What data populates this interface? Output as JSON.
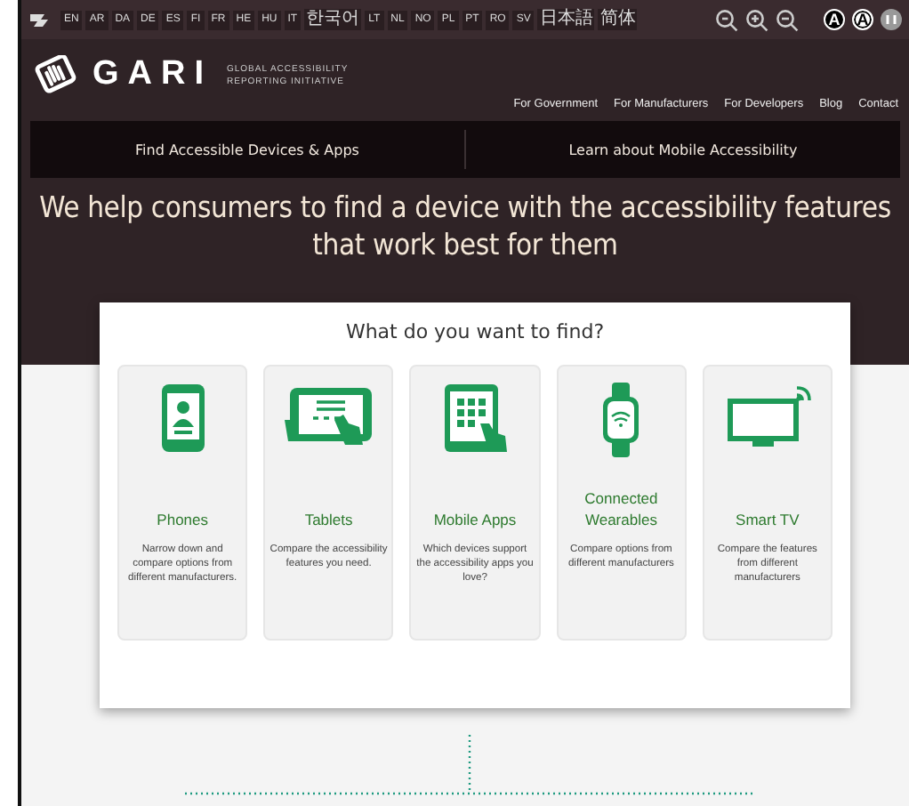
{
  "languages": [
    "EN",
    "AR",
    "DA",
    "DE",
    "ES",
    "FI",
    "FR",
    "HE",
    "HU",
    "IT",
    "한국어",
    "LT",
    "NL",
    "NO",
    "PL",
    "PT",
    "RO",
    "SV",
    "日本語",
    "简体"
  ],
  "contrast_buttons": [
    {
      "label": "A",
      "kind": "dark"
    },
    {
      "label": "A",
      "kind": "light"
    }
  ],
  "logo": {
    "name": "GARI",
    "tagline_1": "GLOBAL ACCESSIBILITY",
    "tagline_2": "REPORTING INITIATIVE"
  },
  "menu": [
    "For Government",
    "For Manufacturers",
    "For Developers",
    "Blog",
    "Contact"
  ],
  "tabs": [
    "Find Accessible Devices & Apps",
    "Learn about Mobile Accessibility"
  ],
  "headline": "We help consumers to find a device with the accessibility features that work best for them",
  "finder": {
    "title": "What do you want to find?",
    "items": [
      {
        "title": "Phones",
        "text": "Narrow down and compare options from different manufacturers."
      },
      {
        "title": "Tablets",
        "text": "Compare the accessibility features you need."
      },
      {
        "title": "Mobile Apps",
        "text": "Which devices support the accessibility apps you love?"
      },
      {
        "title": "Connected Wearables",
        "text": "Compare options from different manufacturers"
      },
      {
        "title": "Smart TV",
        "text": "Compare the features from different manufacturers"
      }
    ]
  }
}
